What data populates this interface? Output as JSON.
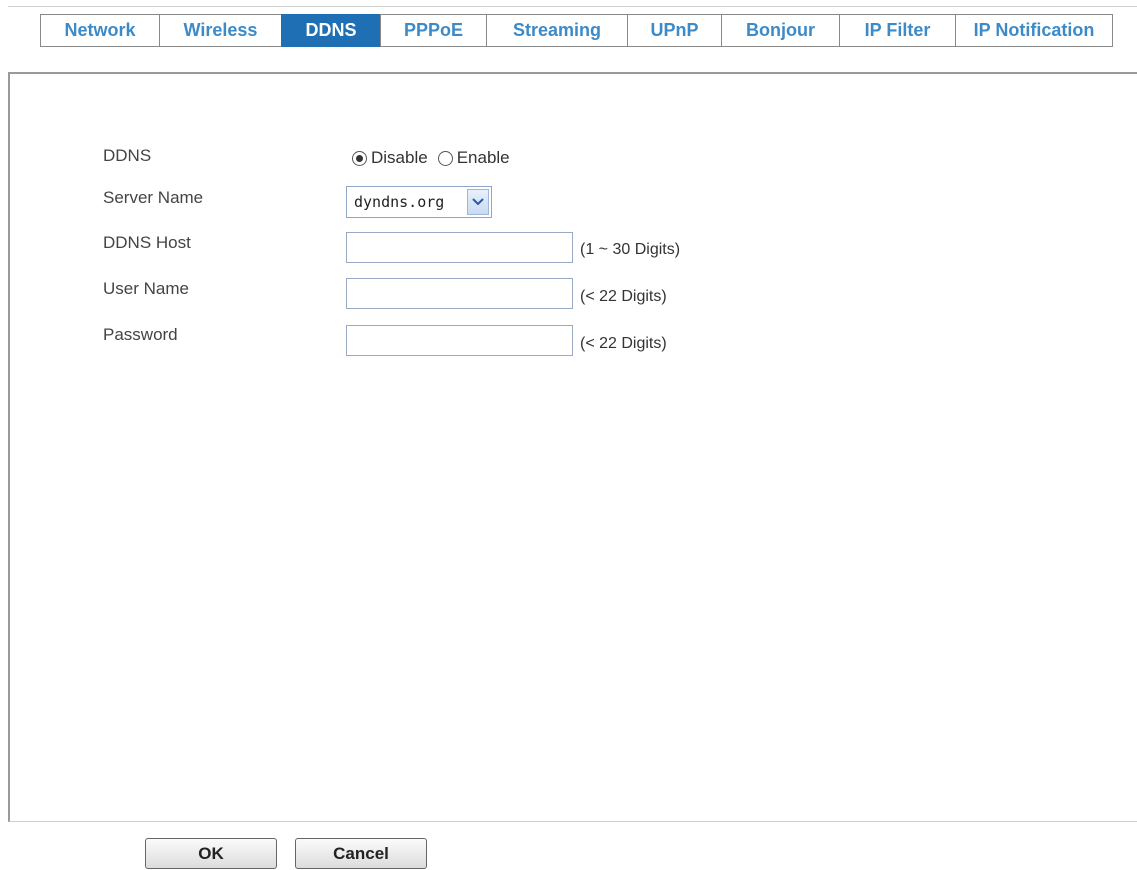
{
  "tabs": [
    {
      "label": "Network",
      "active": false
    },
    {
      "label": "Wireless",
      "active": false
    },
    {
      "label": "DDNS",
      "active": true
    },
    {
      "label": "PPPoE",
      "active": false
    },
    {
      "label": "Streaming",
      "active": false
    },
    {
      "label": "UPnP",
      "active": false
    },
    {
      "label": "Bonjour",
      "active": false
    },
    {
      "label": "IP Filter",
      "active": false
    },
    {
      "label": "IP Notification",
      "active": false
    }
  ],
  "form": {
    "ddns": {
      "label": "DDNS",
      "options": [
        "Disable",
        "Enable"
      ],
      "selected": "Disable"
    },
    "server_name": {
      "label": "Server Name",
      "value": "dyndns.org"
    },
    "ddns_host": {
      "label": "DDNS Host",
      "value": "",
      "hint": "(1 ~ 30 Digits)"
    },
    "user_name": {
      "label": "User Name",
      "value": "",
      "hint": "(< 22 Digits)"
    },
    "password": {
      "label": "Password",
      "value": "",
      "hint": "(< 22 Digits)"
    }
  },
  "buttons": {
    "ok": "OK",
    "cancel": "Cancel"
  },
  "colors": {
    "tab_text": "#3d8ac8",
    "tab_active_bg": "#1f6fb4"
  }
}
